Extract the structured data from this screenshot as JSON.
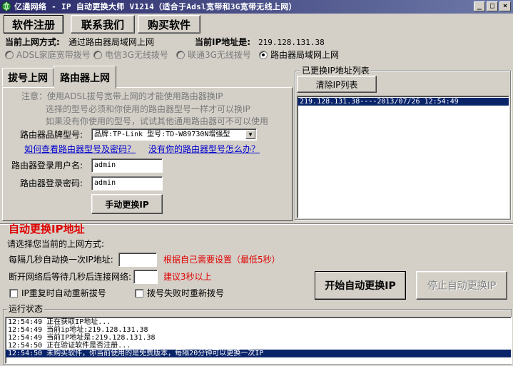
{
  "window": {
    "title": "亿通网络 - IP 自动更换大师 V1214（适合于Adsl宽带和3G宽带无线上网）",
    "controls": {
      "minimize": "_",
      "maximize": "□",
      "close": "×"
    }
  },
  "toolbar": {
    "register_label": "软件注册",
    "contact_label": "联系我们",
    "buy_label": "购买软件"
  },
  "status_line": {
    "mode_label": "当前上网方式:",
    "mode_value": "通过路由器局域网上网",
    "ip_label": "当前IP地址是:",
    "ip_value": "219.128.131.38"
  },
  "connection_modes": [
    {
      "label": "ADSL家庭宽带拨号",
      "selected": false,
      "enabled": false
    },
    {
      "label": "电信3G无线拨号",
      "selected": false,
      "enabled": false
    },
    {
      "label": "联通3G无线拨号",
      "selected": false,
      "enabled": false
    },
    {
      "label": "路由器局域网上网",
      "selected": true,
      "enabled": true
    }
  ],
  "tabs": [
    {
      "label": "拔号上网",
      "active": false
    },
    {
      "label": "路由器上网",
      "active": true
    }
  ],
  "router_panel": {
    "note_lines": [
      "注意：使用ADSL拔号宽带上网的才能使用路由器换IP",
      "选择的型号必须和你使用的路由器型号一样才可以换IP",
      "如果没有你使用的型号，试试其他通用路由器可不可以使用"
    ],
    "brand_label": "路由器品牌型号:",
    "brand_value": "品牌:TP-Link 型号:TD-W89730N增强型",
    "link_how_to_check": "如何查看路由器型号及密码？",
    "link_no_model": "没有你的路由器型号怎么办？",
    "username_label": "路由器登录用户名:",
    "username_value": "admin",
    "password_label": "路由器登录密码:",
    "password_value": "admin",
    "manual_change_label": "手动更换IP"
  },
  "ip_history": {
    "title": "已更换IP地址列表",
    "clear_label": "清除IP列表",
    "items": [
      "219.128.131.38----2013/07/26 12:54:49"
    ]
  },
  "auto_change": {
    "title": "自动更换IP地址",
    "prompt": "请选择您当前的上网方式:",
    "interval_label": "每隔几秒自动换一次IP地址:",
    "interval_value": "",
    "interval_hint": "根据自己需要设置（最低5秒）",
    "reconnect_label": "断开网络后等待几秒后连接网络:",
    "reconnect_value": "",
    "reconnect_hint": "建议3秒以上",
    "restart_redial_label": "IP重复时自动重新拔号",
    "fail_redial_label": "拨号失败时重新拨号",
    "start_label": "开始自动更换IP",
    "stop_label": "停止自动更换IP"
  },
  "log": {
    "title": "运行状态",
    "lines": [
      "12:54:49 正在获取IP地址...",
      "12:54:49 当前ip地址:219.128.131.38",
      "12:54:49 当前IP地址是:219.128.131.38",
      "12:54:50 正在验证软件是否注册...",
      "12:54:50 未购买软件，你当前使用的是免费版本，每隔20分钟可以更换一次IP"
    ]
  },
  "colors": {
    "title_bar_start": "#2a2a6a",
    "title_bar_end": "#6e7aa8",
    "face": "#d4d0c8",
    "selection": "#0a246a",
    "heading_red": "#e00000",
    "link_blue": "#0000cc"
  },
  "icons": {
    "app": "globe-app-icon"
  }
}
